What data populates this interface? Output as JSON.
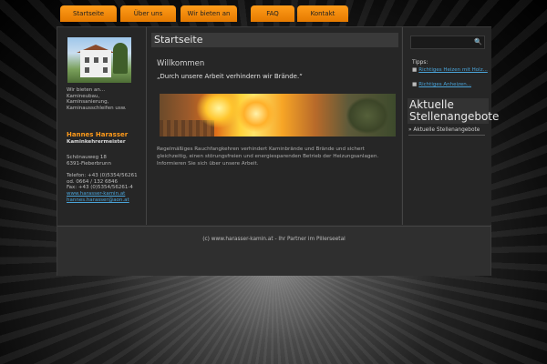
{
  "nav": {
    "items": [
      {
        "label": "Startseite"
      },
      {
        "label": "Über uns"
      },
      {
        "label": "Wir bieten an"
      },
      {
        "label": "FAQ"
      },
      {
        "label": "Kontakt"
      }
    ]
  },
  "sidebar_left": {
    "offer_lines": [
      "Wir bieten an...",
      "Kamineubau,",
      "Kaminsanierung,",
      "Kaminausschleifen usw."
    ],
    "name": "Hannes Harasser",
    "profession": "Kaminkehrermeister",
    "address": [
      "Schönauweg 18",
      "6391-Fieberbrunn"
    ],
    "phone": [
      "Telefon: +43 (0)5354/56261",
      "od. 0664 / 132 6846",
      "Fax: +43 (0)5354/56261-4"
    ],
    "website": "www.harasser-kamin.at",
    "email": "hannes.harasser@aon.at"
  },
  "main": {
    "title": "Startseite",
    "welcome": "Willkommen",
    "quote": "„Durch unsere Arbeit verhindern wir Brände.“",
    "body": "Regelmäßiges Rauchfangkehren verhindert Kaminbrände und Brände und sichert gleichzeitig, einen störungsfreien und energiesparenden Betrieb der Heizungsanlagen. Informieren Sie sich über unsere Arbeit."
  },
  "sidebar_right": {
    "search_placeholder": "",
    "tips_label": "Tipps:",
    "tips": [
      "Richtiges Heizen mit Holz...",
      "Richtiges Anheizen..."
    ],
    "heading": "Aktuelle Stellenangebote",
    "item": "Aktuelle Stellenangebote"
  },
  "footer": {
    "text": "(c) www.harasser-kamin.at - Ihr Partner im Pillerseetal"
  },
  "icons": {
    "search": "search-icon"
  },
  "colors": {
    "accent": "#ff9a1a",
    "link": "#4aa3d8"
  }
}
